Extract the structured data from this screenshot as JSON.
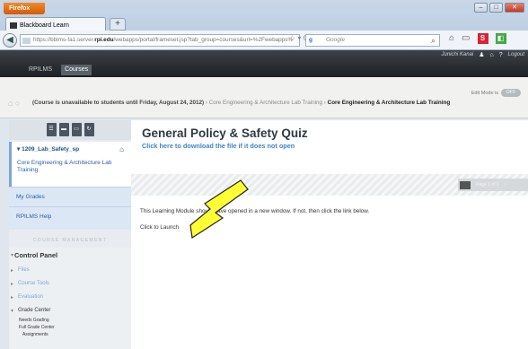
{
  "browser": {
    "app_button": "Firefox",
    "tab_title": "Blackboard Learn",
    "new_tab": "+",
    "url_pre": "https://bblms-fa1.server.",
    "url_domain": "rpi.edu",
    "url_post": "/webapps/portal/frameset.jsp?tab_group=courses&url=%2Fwebapps%",
    "search_placeholder": "Google",
    "window_buttons": [
      "–",
      "□",
      "✕"
    ]
  },
  "bb": {
    "user_name": "Junichi Kanai",
    "logout": "Logout",
    "tabs": [
      "RPILMS",
      "Courses"
    ]
  },
  "crumb": {
    "edit_mode_label": "Edit Mode is",
    "edit_mode_state": "OFF",
    "notice": "(Course is unavailable to students until Friday, August 24, 2012)",
    "items": [
      "Core Engineering & Architecture Lab Training"
    ],
    "current": "Core Engineering & Architecture Lab Training"
  },
  "sidebar": {
    "course_id": "1209_Lab_Safety_sp",
    "course_link": "Core Engineering & Architecture Lab Training",
    "links": [
      "My Grades",
      "RPILMS Help"
    ],
    "management_heading": "COURSE MANAGEMENT",
    "control_panel": "Control Panel",
    "cp_items": [
      "Files",
      "Course Tools",
      "Evaluation"
    ],
    "grade_center": "Grade Center",
    "gc_items": [
      "Needs Grading",
      "Full Grade Center",
      "Assignments"
    ]
  },
  "main": {
    "title": "General Policy & Safety Quiz",
    "download_link": "Click here to download the file if it does not open",
    "message": "This Learning Module should have opened in a new window. If not, then click the link below.",
    "launch": "Click to Launch",
    "pager": "Page 1 of 1"
  },
  "colors": {
    "accent": "#3c85c7",
    "arrow": "#ffff33"
  }
}
